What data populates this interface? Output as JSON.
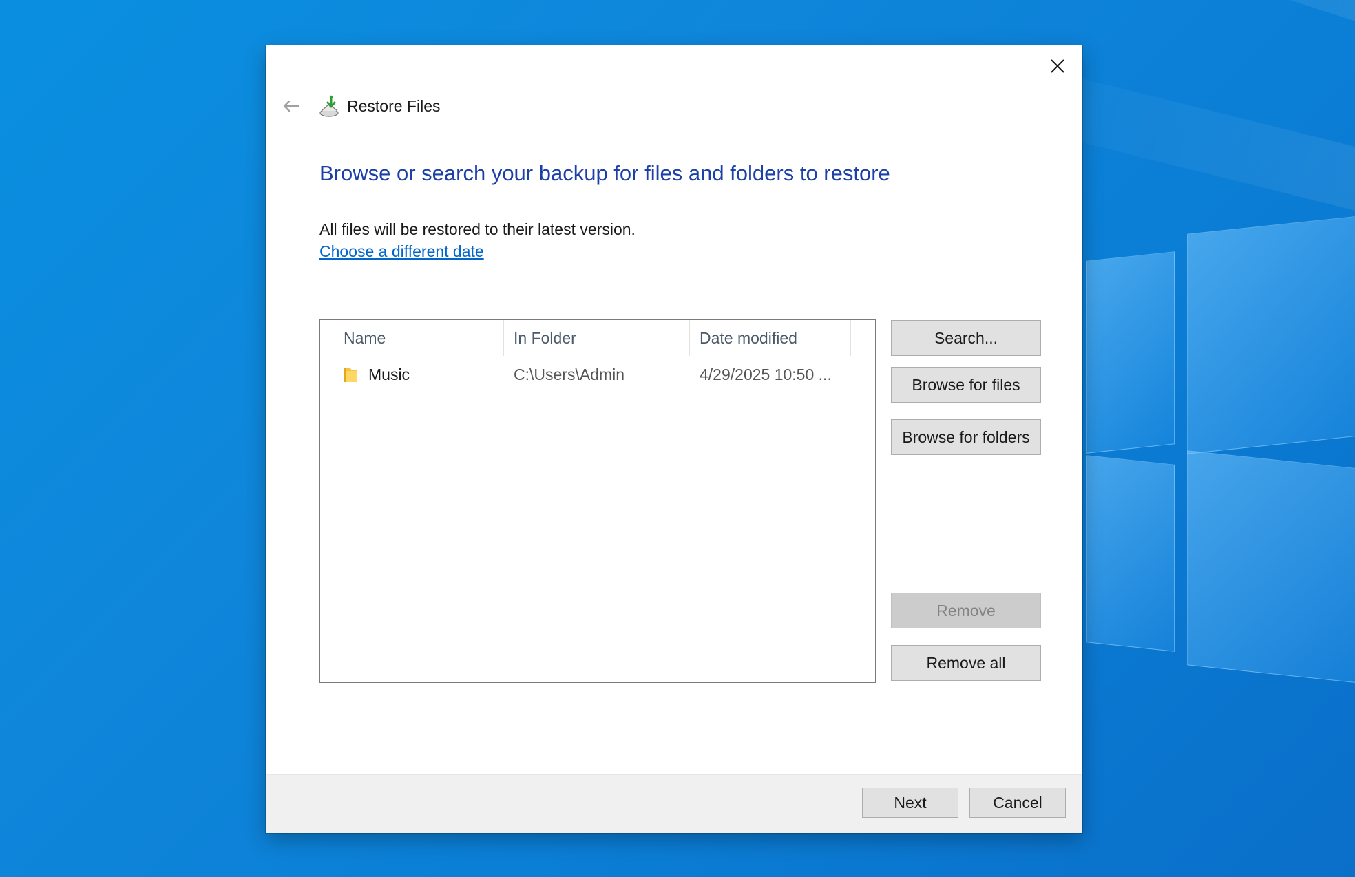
{
  "dialog": {
    "title": "Restore Files",
    "heading": "Browse or search your backup for files and folders to restore",
    "info_text": "All files will be restored to their latest version.",
    "link_text": "Choose a different date"
  },
  "list": {
    "columns": [
      "Name",
      "In Folder",
      "Date modified"
    ],
    "rows": [
      {
        "name": "Music",
        "folder": "C:\\Users\\Admin",
        "date": "4/29/2025 10:50 ...",
        "icon": "folder-icon"
      }
    ]
  },
  "side_buttons": {
    "search": "Search...",
    "browse_files": "Browse for files",
    "browse_folders": "Browse for folders",
    "remove": "Remove",
    "remove_all": "Remove all"
  },
  "footer": {
    "next": "Next",
    "cancel": "Cancel"
  },
  "colors": {
    "heading": "#1c3fa8",
    "link": "#0066cc",
    "desktop": "#0b86da"
  }
}
